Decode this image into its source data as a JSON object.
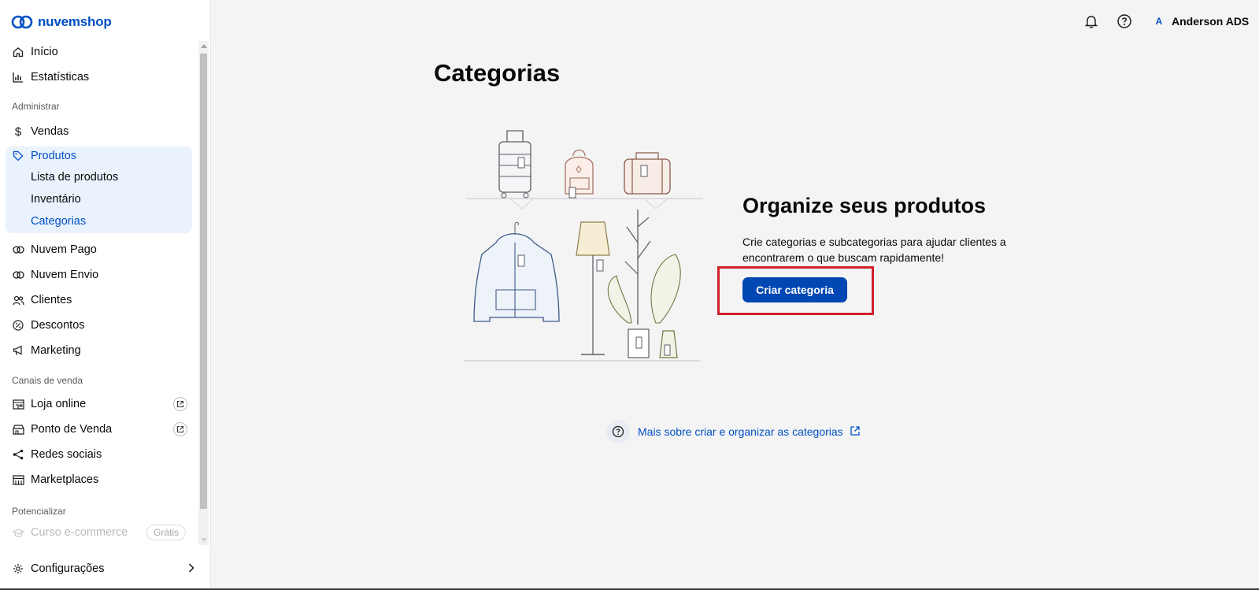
{
  "brand": {
    "logo_text": "nuvemshop",
    "accent": "#0050c3"
  },
  "sidebar": {
    "top_items": [
      {
        "label": "Início",
        "icon": "home-icon"
      },
      {
        "label": "Estatísticas",
        "icon": "chart-icon"
      }
    ],
    "section_admin": "Administrar",
    "admin_items": [
      {
        "label": "Vendas",
        "icon": "dollar-icon"
      },
      {
        "label": "Produtos",
        "icon": "tag-icon",
        "active": true
      }
    ],
    "produtos_sub": [
      {
        "label": "Lista de produtos"
      },
      {
        "label": "Inventário"
      },
      {
        "label": "Categorias",
        "active": true
      }
    ],
    "more_items": [
      {
        "label": "Nuvem Pago",
        "icon": "nuvem-icon"
      },
      {
        "label": "Nuvem Envio",
        "icon": "nuvem-icon"
      },
      {
        "label": "Clientes",
        "icon": "users-icon"
      },
      {
        "label": "Descontos",
        "icon": "percent-icon"
      },
      {
        "label": "Marketing",
        "icon": "megaphone-icon"
      }
    ],
    "section_canais": "Canais de venda",
    "canais_items": [
      {
        "label": "Loja online",
        "icon": "store-icon",
        "external": true
      },
      {
        "label": "Ponto de Venda",
        "icon": "pos-icon",
        "external": true
      },
      {
        "label": "Redes sociais",
        "icon": "share-icon"
      },
      {
        "label": "Marketplaces",
        "icon": "marketplace-icon"
      }
    ],
    "section_potencializar": "Potencializar",
    "curso": {
      "label": "Curso e-commerce",
      "badge": "Grátis"
    },
    "config_label": "Configurações"
  },
  "topbar": {
    "user_initial": "A",
    "user_name": "Anderson ADS"
  },
  "main": {
    "title": "Categorias",
    "empty_title": "Organize seus produtos",
    "empty_desc": "Crie categorias e subcategorias para ajudar clientes a encontrarem o que buscam rapidamente!",
    "primary_button": "Criar categoria",
    "help_link": "Mais sobre criar e organizar as categorias"
  },
  "colors": {
    "highlight": "#d0212a",
    "primary": "#0047b3",
    "active_bg": "#eaf2fd"
  }
}
